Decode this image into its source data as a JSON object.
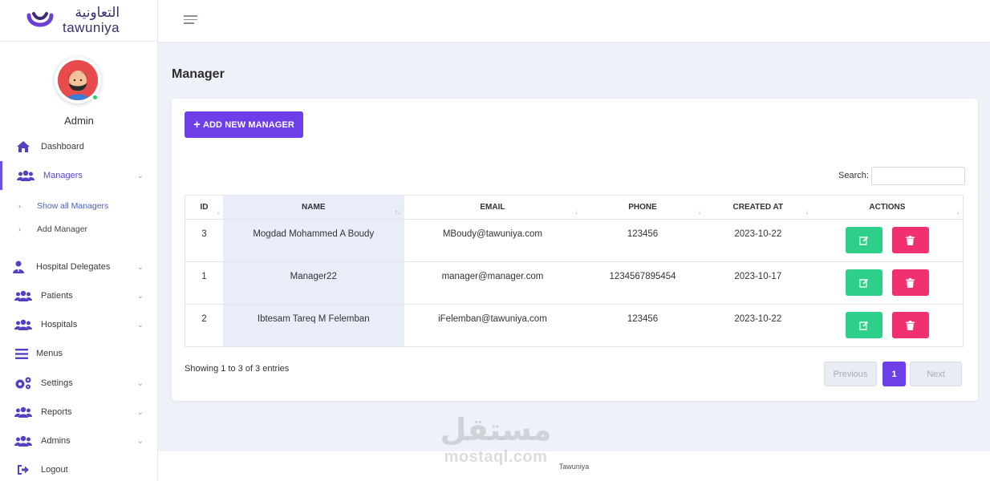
{
  "brand": {
    "arabic": "التعاونية",
    "english": "tawuniya"
  },
  "user": {
    "name": "Admin"
  },
  "sidebar": {
    "items": [
      {
        "label": "Dashboard",
        "icon": "home-icon"
      },
      {
        "label": "Managers",
        "icon": "users-icon",
        "active": true
      },
      {
        "label": "Hospital Delegates",
        "icon": "user-tie-icon"
      },
      {
        "label": "Patients",
        "icon": "users-icon"
      },
      {
        "label": "Hospitals",
        "icon": "users-icon"
      },
      {
        "label": "Menus",
        "icon": "menu-icon"
      },
      {
        "label": "Settings",
        "icon": "gears-icon"
      },
      {
        "label": "Reports",
        "icon": "users-icon"
      },
      {
        "label": "Admins",
        "icon": "users-icon"
      },
      {
        "label": "Logout",
        "icon": "logout-icon"
      }
    ],
    "subitems": [
      {
        "label": "Show all Managers"
      },
      {
        "label": "Add Manager"
      }
    ]
  },
  "page": {
    "title": "Manager"
  },
  "toolbar": {
    "add_label": "ADD NEW MANAGER",
    "search_label": "Search:",
    "search_value": ""
  },
  "table": {
    "headers": [
      "ID",
      "NAME",
      "EMAIL",
      "PHONE",
      "CREATED AT",
      "ACTIONS"
    ],
    "rows": [
      {
        "id": "3",
        "name": "Mogdad Mohammed A Boudy",
        "email": "MBoudy@tawuniya.com",
        "phone": "123456",
        "created": "2023-10-22"
      },
      {
        "id": "1",
        "name": "Manager22",
        "email": "manager@manager.com",
        "phone": "1234567895454",
        "created": "2023-10-17"
      },
      {
        "id": "2",
        "name": "Ibtesam Tareq M Felemban",
        "email": "iFelemban@tawuniya.com",
        "phone": "123456",
        "created": "2023-10-22"
      }
    ]
  },
  "pagination": {
    "info": "Showing 1 to 3 of 3 entries",
    "previous": "Previous",
    "current": "1",
    "next": "Next"
  },
  "footer": {
    "text": "Tawuniya"
  },
  "watermark": {
    "arabic": "مستقل",
    "english": "mostaql.com"
  },
  "colors": {
    "primary": "#6c3fe8",
    "edit": "#2ecf89",
    "delete": "#f1306f",
    "online": "#2ecc71"
  }
}
